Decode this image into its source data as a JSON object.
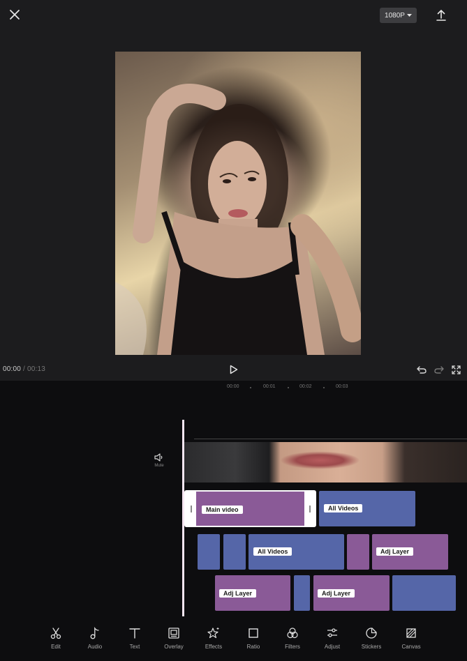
{
  "header": {
    "close_icon": "close-icon",
    "resolution": "1080P",
    "export_icon": "upload-icon"
  },
  "preview": {
    "description": "video-frame-portrait"
  },
  "playback": {
    "current_time": "00:00",
    "separator": " / ",
    "total_time": "00:13"
  },
  "ruler": {
    "ticks": [
      "00:00",
      "00:01",
      "00:02",
      "00:03"
    ]
  },
  "timeline": {
    "mute_label": "Mute",
    "clips": {
      "main_video": "Main video",
      "all_videos_1": "All Videos",
      "all_videos_2": "All Videos",
      "adj_layer_1": "Adj Layer",
      "adj_layer_2": "Adj Layer",
      "adj_layer_3": "Adj Layer"
    }
  },
  "colors": {
    "clip_purple": "#8a5a97",
    "clip_blue": "#5566a8",
    "playhead": "#f6e6f2"
  },
  "toolbar": {
    "items": [
      {
        "label": "Edit",
        "icon": "scissors-icon"
      },
      {
        "label": "Audio",
        "icon": "music-note-icon"
      },
      {
        "label": "Text",
        "icon": "text-icon"
      },
      {
        "label": "Overlay",
        "icon": "overlay-icon"
      },
      {
        "label": "Effects",
        "icon": "effects-star-icon"
      },
      {
        "label": "Ratio",
        "icon": "ratio-square-icon"
      },
      {
        "label": "Filters",
        "icon": "filters-icon"
      },
      {
        "label": "Adjust",
        "icon": "adjust-sliders-icon"
      },
      {
        "label": "Stickers",
        "icon": "sticker-icon"
      },
      {
        "label": "Canvas",
        "icon": "canvas-icon"
      }
    ]
  }
}
